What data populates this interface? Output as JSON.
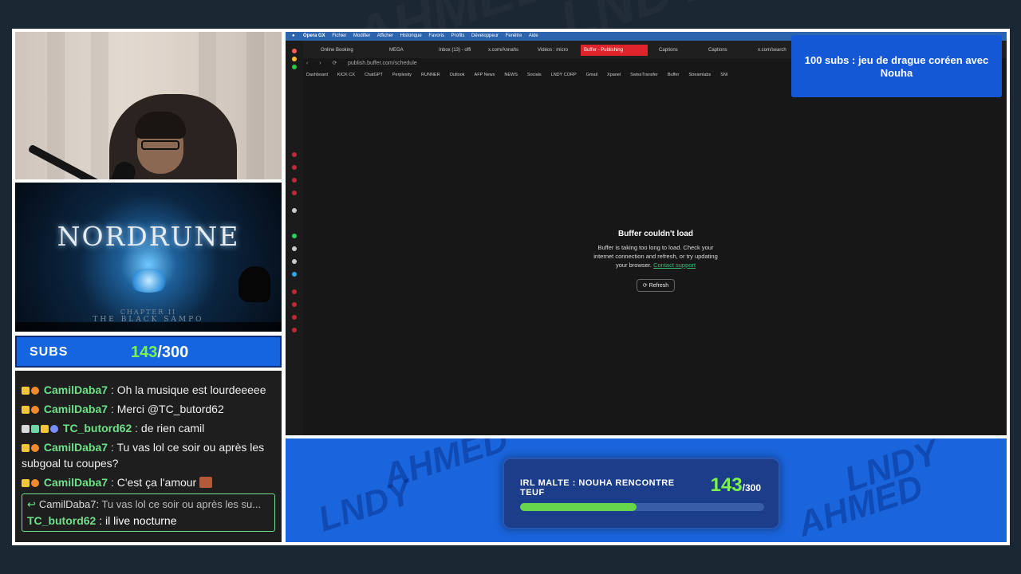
{
  "notification": {
    "text": "100 subs : jeu de drague coréen avec Nouha"
  },
  "subs_widget": {
    "label": "SUBS",
    "current": "143",
    "separator_total": "/300"
  },
  "goal_widget": {
    "title": "IRL MALTE : NOUHA RENCONTRE TEUF",
    "current": "143",
    "total": "/300",
    "progress": 0.4767
  },
  "game_thumb": {
    "title": "NORDRUNE",
    "chapter": "CHAPTER II",
    "subtitle": "THE BLACK SAMPO"
  },
  "chat": {
    "messages": [
      {
        "user": "CamilDaba7",
        "text": "Oh la musique est lourdeeeee"
      },
      {
        "user": "CamilDaba7",
        "text": "Merci @TC_butord62"
      },
      {
        "user": "TC_butord62",
        "text": "de rien camil"
      },
      {
        "user": "CamilDaba7",
        "text": "Tu vas lol ce soir ou après les subgoal tu coupes?"
      },
      {
        "user": "CamilDaba7",
        "text": "C'est ça l'amour"
      }
    ],
    "reply": {
      "quote_user": "CamilDaba7:",
      "quote_text": "Tu vas lol ce soir ou après les su...",
      "user": "TC_butord62",
      "text": "il live nocturne"
    }
  },
  "browser": {
    "menubar": {
      "app": "Opera GX",
      "items": [
        "Fichier",
        "Modifier",
        "Afficher",
        "Historique",
        "Favoris",
        "Profils",
        "Développeur",
        "Fenêtre",
        "Aide"
      ]
    },
    "tabs": [
      "Online Booking",
      "MEGA",
      "Inbox (13) - offi",
      "x.com/Annahs",
      "Vidéos : micro",
      "Buffer - Publishing",
      "Captions",
      "Captions",
      "x.com/search"
    ],
    "url": "publish.buffer.com/schedule",
    "bookmarks": [
      "Dashboard",
      "KICK CX",
      "ChatGPT",
      "Perplexity",
      "RUNNER",
      "Outlook",
      "AFP News",
      "NEWS",
      "Socials",
      "LNDY CORP",
      "Gmail",
      "Xpanel",
      "SwissTransfer",
      "Buffer",
      "Streamlabs",
      "SNI"
    ],
    "error": {
      "title": "Buffer couldn't load",
      "desc": "Buffer is taking too long to load. Check your internet connection and refresh, or try updating your browser.",
      "link": "Contact support",
      "button": "Refresh"
    }
  },
  "watermark": {
    "brand1": "AHMED",
    "brand2": "LNDY"
  },
  "colors": {
    "accent_blue": "#1565e0",
    "green": "#7cf24e",
    "chat_user": "#6fe08a",
    "tab_active": "#e0242c"
  }
}
